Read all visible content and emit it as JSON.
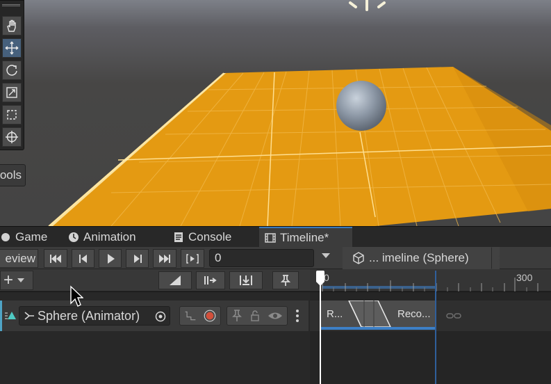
{
  "scene_tools": {
    "tools": [
      "hand-tool",
      "move-tool",
      "rotate-tool",
      "scale-tool",
      "rect-tool",
      "transform-tool"
    ],
    "active_tool": "move-tool",
    "overlay_label": "ools"
  },
  "tabs": [
    {
      "label": "Game",
      "icon": "game-icon"
    },
    {
      "label": "Animation",
      "icon": "clock-icon"
    },
    {
      "label": "Console",
      "icon": "console-icon"
    },
    {
      "label": "Timeline*",
      "icon": "film-icon",
      "active": true
    }
  ],
  "timeline_toolbar": {
    "preview_label": "eview",
    "frame_value": "0",
    "breadcrumb": "... imeline (Sphere)",
    "buttons": [
      "go-to-start",
      "previous-frame",
      "play",
      "next-frame",
      "go-to-end",
      "play-range"
    ]
  },
  "track_header": {
    "buttons": [
      "add-track",
      "show-curves",
      "snap-to-frame",
      "ripple-edit",
      "markers"
    ]
  },
  "ruler": {
    "labels": [
      "0",
      "300"
    ]
  },
  "track": {
    "binding": "Sphere (Animator)",
    "color": "#4fa4c6",
    "clips": [
      {
        "label": "R..."
      },
      {
        "label": "Reco..."
      }
    ]
  },
  "colors": {
    "ground": "#e49a12",
    "accent": "#3a79bb",
    "clip_underline": "#3d7fc6"
  }
}
